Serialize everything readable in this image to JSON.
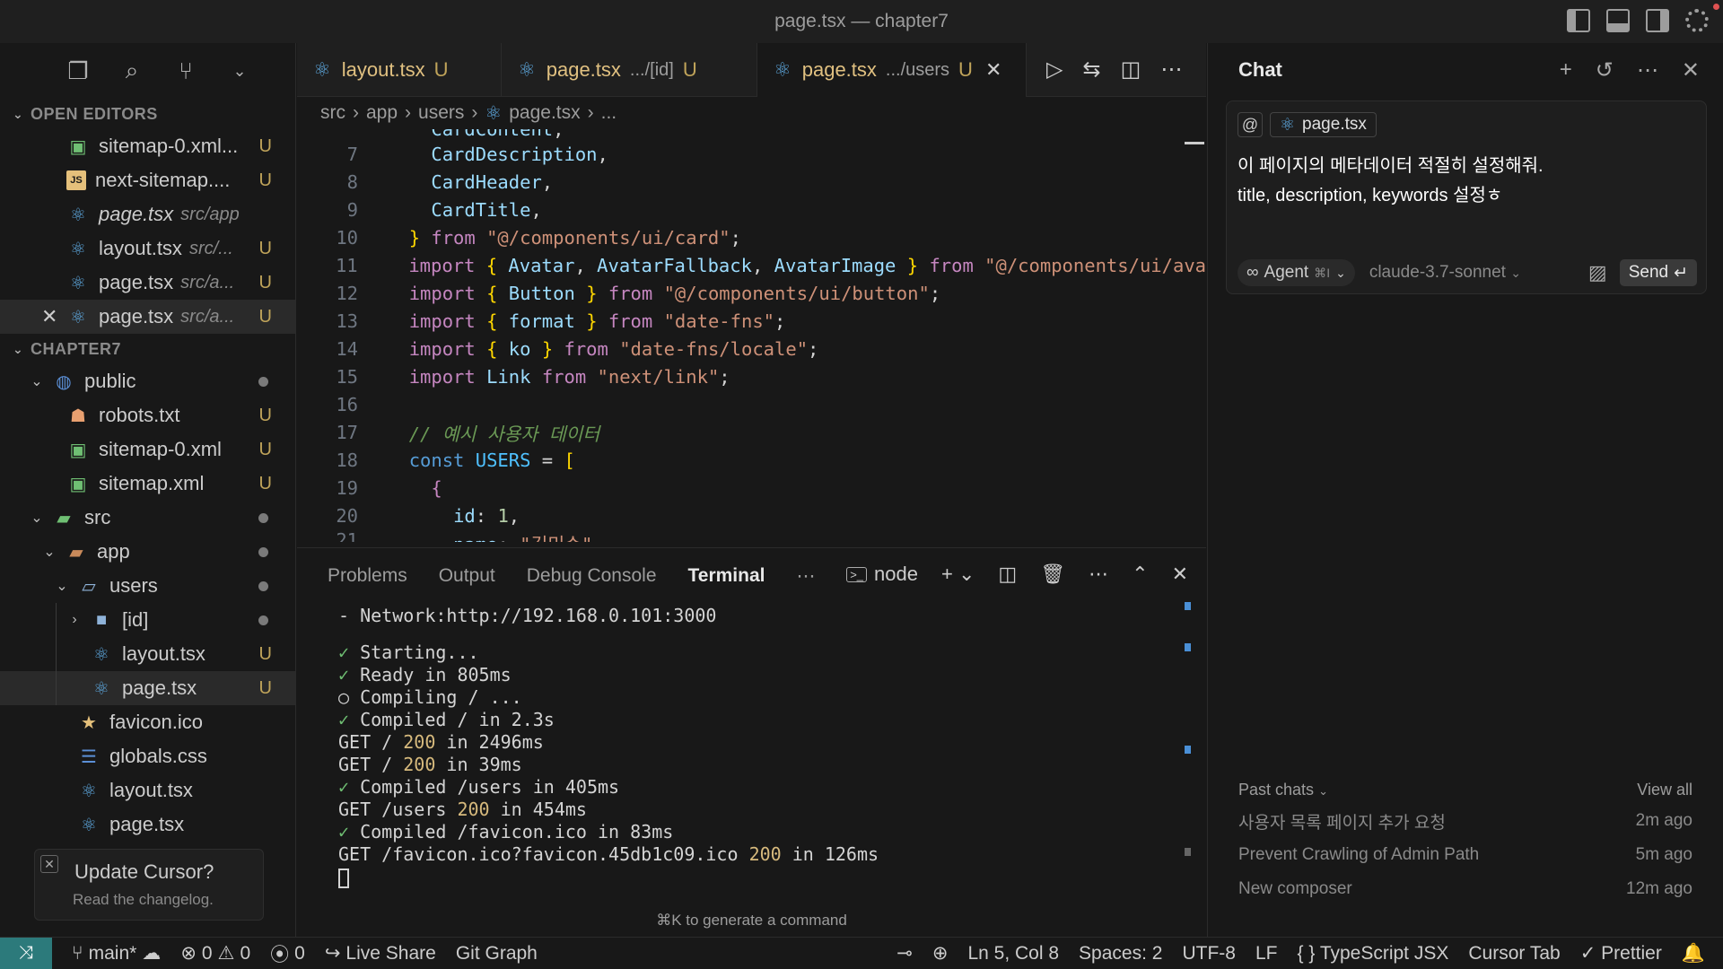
{
  "window": {
    "title": "page.tsx — chapter7"
  },
  "sidebar": {
    "open_editors_label": "OPEN EDITORS",
    "open_editors": [
      {
        "name": "sitemap-0.xml...",
        "path": "",
        "badge": "U",
        "icon": "xml-icon"
      },
      {
        "name": "next-sitemap....",
        "path": "",
        "badge": "U",
        "icon": "js-icon"
      },
      {
        "name": "page.tsx",
        "path": "src/app",
        "badge": "",
        "icon": "react-icon"
      },
      {
        "name": "layout.tsx",
        "path": "src/...",
        "badge": "U",
        "icon": "react-icon"
      },
      {
        "name": "page.tsx",
        "path": "src/a...",
        "badge": "U",
        "icon": "react-icon"
      },
      {
        "name": "page.tsx",
        "path": "src/a...",
        "badge": "U",
        "icon": "react-icon"
      }
    ],
    "project_label": "CHAPTER7",
    "tree": {
      "public": "public",
      "robots": "robots.txt",
      "sitemap0": "sitemap-0.xml",
      "sitemap": "sitemap.xml",
      "src": "src",
      "app": "app",
      "users": "users",
      "id": "[id]",
      "users_layout": "layout.tsx",
      "users_page": "page.tsx",
      "favicon": "favicon.ico",
      "globals": "globals.css",
      "app_layout": "layout.tsx",
      "app_page": "page.tsx",
      "badge_u": "U"
    },
    "update": {
      "title": "Update Cursor?",
      "subtitle": "Read the changelog."
    }
  },
  "editor": {
    "tabs": [
      {
        "name": "layout.tsx",
        "sub": "",
        "badge": "U"
      },
      {
        "name": "page.tsx",
        "sub": ".../[id]",
        "badge": "U"
      },
      {
        "name": "page.tsx",
        "sub": ".../users",
        "badge": "U"
      }
    ],
    "breadcrumb": {
      "a": "src",
      "b": "app",
      "c": "users",
      "d": "page.tsx",
      "e": "..."
    },
    "line_numbers": [
      "7",
      "8",
      "9",
      "10",
      "11",
      "12",
      "13",
      "14",
      "15",
      "16",
      "17",
      "18",
      "19",
      "20",
      "21"
    ]
  },
  "panel": {
    "tabs": {
      "problems": "Problems",
      "output": "Output",
      "debug": "Debug Console",
      "terminal": "Terminal"
    },
    "shell": "node",
    "terminal": {
      "network_label": "- Network:",
      "network_url": "http://192.168.0.101:3000",
      "l1": "Starting...",
      "l2": "Ready in 805ms",
      "l3": "Compiling / ...",
      "l4": "Compiled / in 2.3s",
      "l5a": "GET / ",
      "l5b": "200",
      "l5c": " in 2496ms",
      "l6a": "GET / ",
      "l6b": "200",
      "l6c": " in 39ms",
      "l7": "Compiled /users in 405ms",
      "l8a": "GET /users ",
      "l8b": "200",
      "l8c": " in 454ms",
      "l9": "Compiled /favicon.ico in 83ms",
      "l10a": "GET /favicon.ico?favicon.45db1c09.ico ",
      "l10b": "200",
      "l10c": " in 126ms"
    },
    "hint": "⌘K to generate a command"
  },
  "chat": {
    "title": "Chat",
    "context_chip": "page.tsx",
    "message_line1": "이 페이지의 메타데이터 적절히 설정해줘.",
    "message_line2": "title, description, keywords 설정ㅎ",
    "agent_label": "Agent",
    "agent_shortcut": "⌘I",
    "model": "claude-3.7-sonnet",
    "send_label": "Send",
    "past_label": "Past chats",
    "view_all": "View all",
    "past": [
      {
        "title": "사용자 목록 페이지 추가 요청",
        "time": "2m ago"
      },
      {
        "title": "Prevent Crawling of Admin Path",
        "time": "5m ago"
      },
      {
        "title": "New composer",
        "time": "12m ago"
      }
    ]
  },
  "status": {
    "branch": "main*",
    "errors": "0",
    "warnings": "0",
    "ports": "0",
    "live_share": "Live Share",
    "git_graph": "Git Graph",
    "position": "Ln 5, Col 8",
    "spaces": "Spaces: 2",
    "encoding": "UTF-8",
    "eol": "LF",
    "language": "TypeScript JSX",
    "cursor_tab": "Cursor Tab",
    "prettier": "Prettier"
  }
}
